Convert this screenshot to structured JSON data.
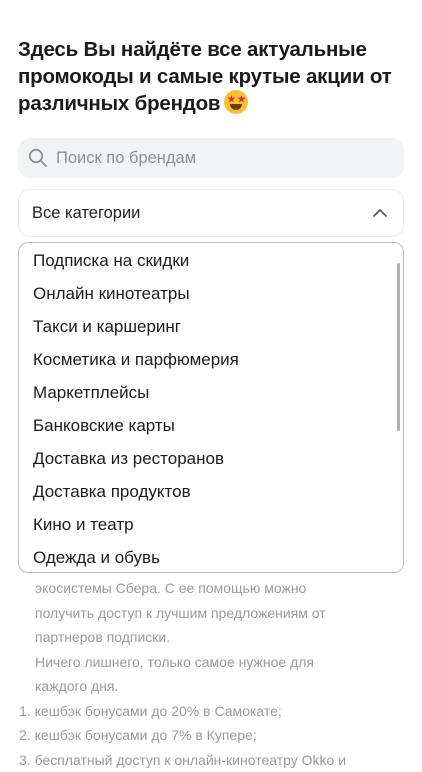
{
  "heading": {
    "line1": "Здесь Вы найдёте все актуальные",
    "line2": "промокоды и самые крутые акции от",
    "line3": "различных брендов"
  },
  "search": {
    "placeholder": "Поиск по брендам",
    "icon": "search-icon"
  },
  "category_select": {
    "selected": "Все категории",
    "icon": "chevron-up-icon"
  },
  "dropdown_options": [
    "Подписка на скидки",
    "Онлайн кинотеатры",
    "Такси и каршеринг",
    "Косметика и парфюмерия",
    "Маркетплейсы",
    "Банковские карты",
    "Доставка из ресторанов",
    "Доставка продуктов",
    "Кино и театр",
    "Одежда и обувь"
  ],
  "background_text": {
    "paragraphs": [
      "экосистемы Сбера. С ее помощью можно",
      "получить доступ к лучшим предложениям от",
      "партнеров подписки.",
      "Ничего лишнего, только самое нужное для",
      "каждого дня."
    ],
    "list": [
      "1. кешбэк бонусами до 20% в Самокате;",
      "2. кешбэк бонусами до 7% в Купере;",
      "3. бесплатный доступ к онлайн-кинотеатру Okko и"
    ]
  }
}
